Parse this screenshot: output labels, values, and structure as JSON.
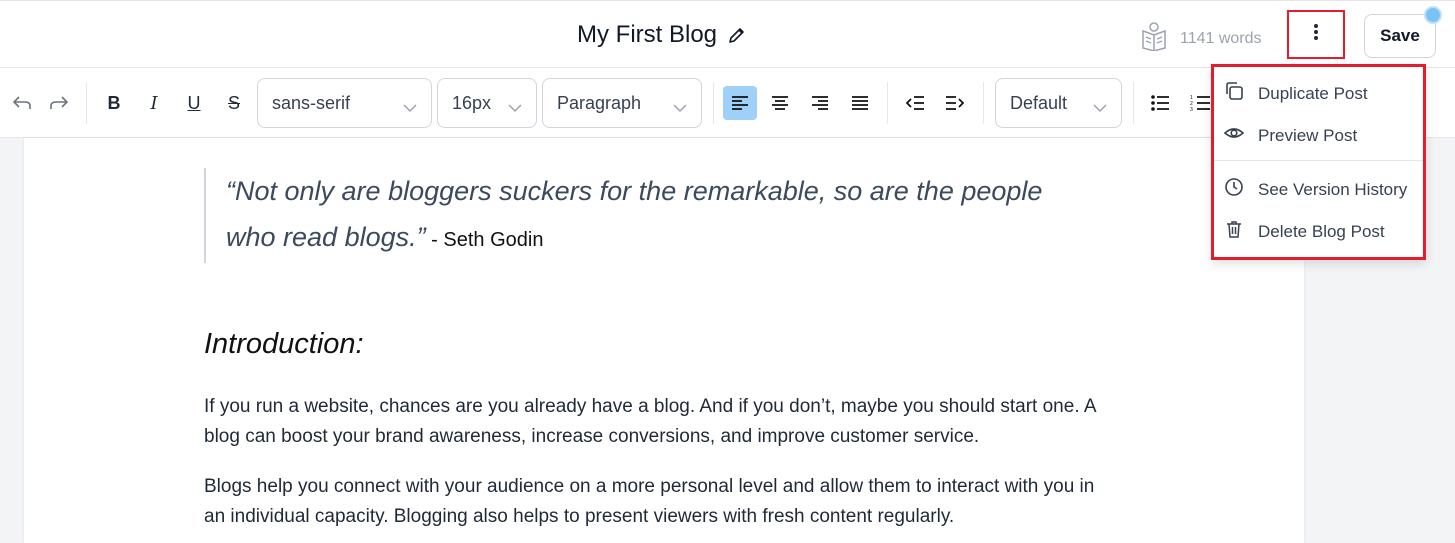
{
  "header": {
    "title": "My First Blog",
    "word_count": "1141 words",
    "save_label": "Save"
  },
  "toolbar": {
    "font_family": "sans-serif",
    "font_size": "16px",
    "block_type": "Paragraph",
    "style_select": "Default",
    "bold": "B",
    "italic": "I",
    "underline": "U",
    "strike": "S"
  },
  "content": {
    "quote_text": "“Not only are bloggers suckers for the remarkable, so are the people who read blogs.”",
    "quote_author": " - Seth Godin",
    "heading": "Introduction:",
    "paragraph1": "If you run a website, chances are you already have a blog. And if you don’t, maybe you should start one. A blog can boost your brand awareness, increase conversions, and improve customer service.",
    "paragraph2": "Blogs help you connect with your audience on a more personal level and allow them to interact with you in an individual capacity. Blogging also helps to present viewers with fresh content regularly."
  },
  "menu": {
    "items": [
      {
        "label": "Duplicate Post",
        "icon": "duplicate-icon"
      },
      {
        "label": "Preview Post",
        "icon": "eye-icon"
      },
      {
        "label": "See Version History",
        "icon": "clock-icon"
      },
      {
        "label": "Delete Blog Post",
        "icon": "trash-icon"
      }
    ]
  },
  "colors": {
    "highlight_border": "#e11d2e",
    "active_align": "#9fd0f7",
    "muted_text": "#9ca3af"
  }
}
